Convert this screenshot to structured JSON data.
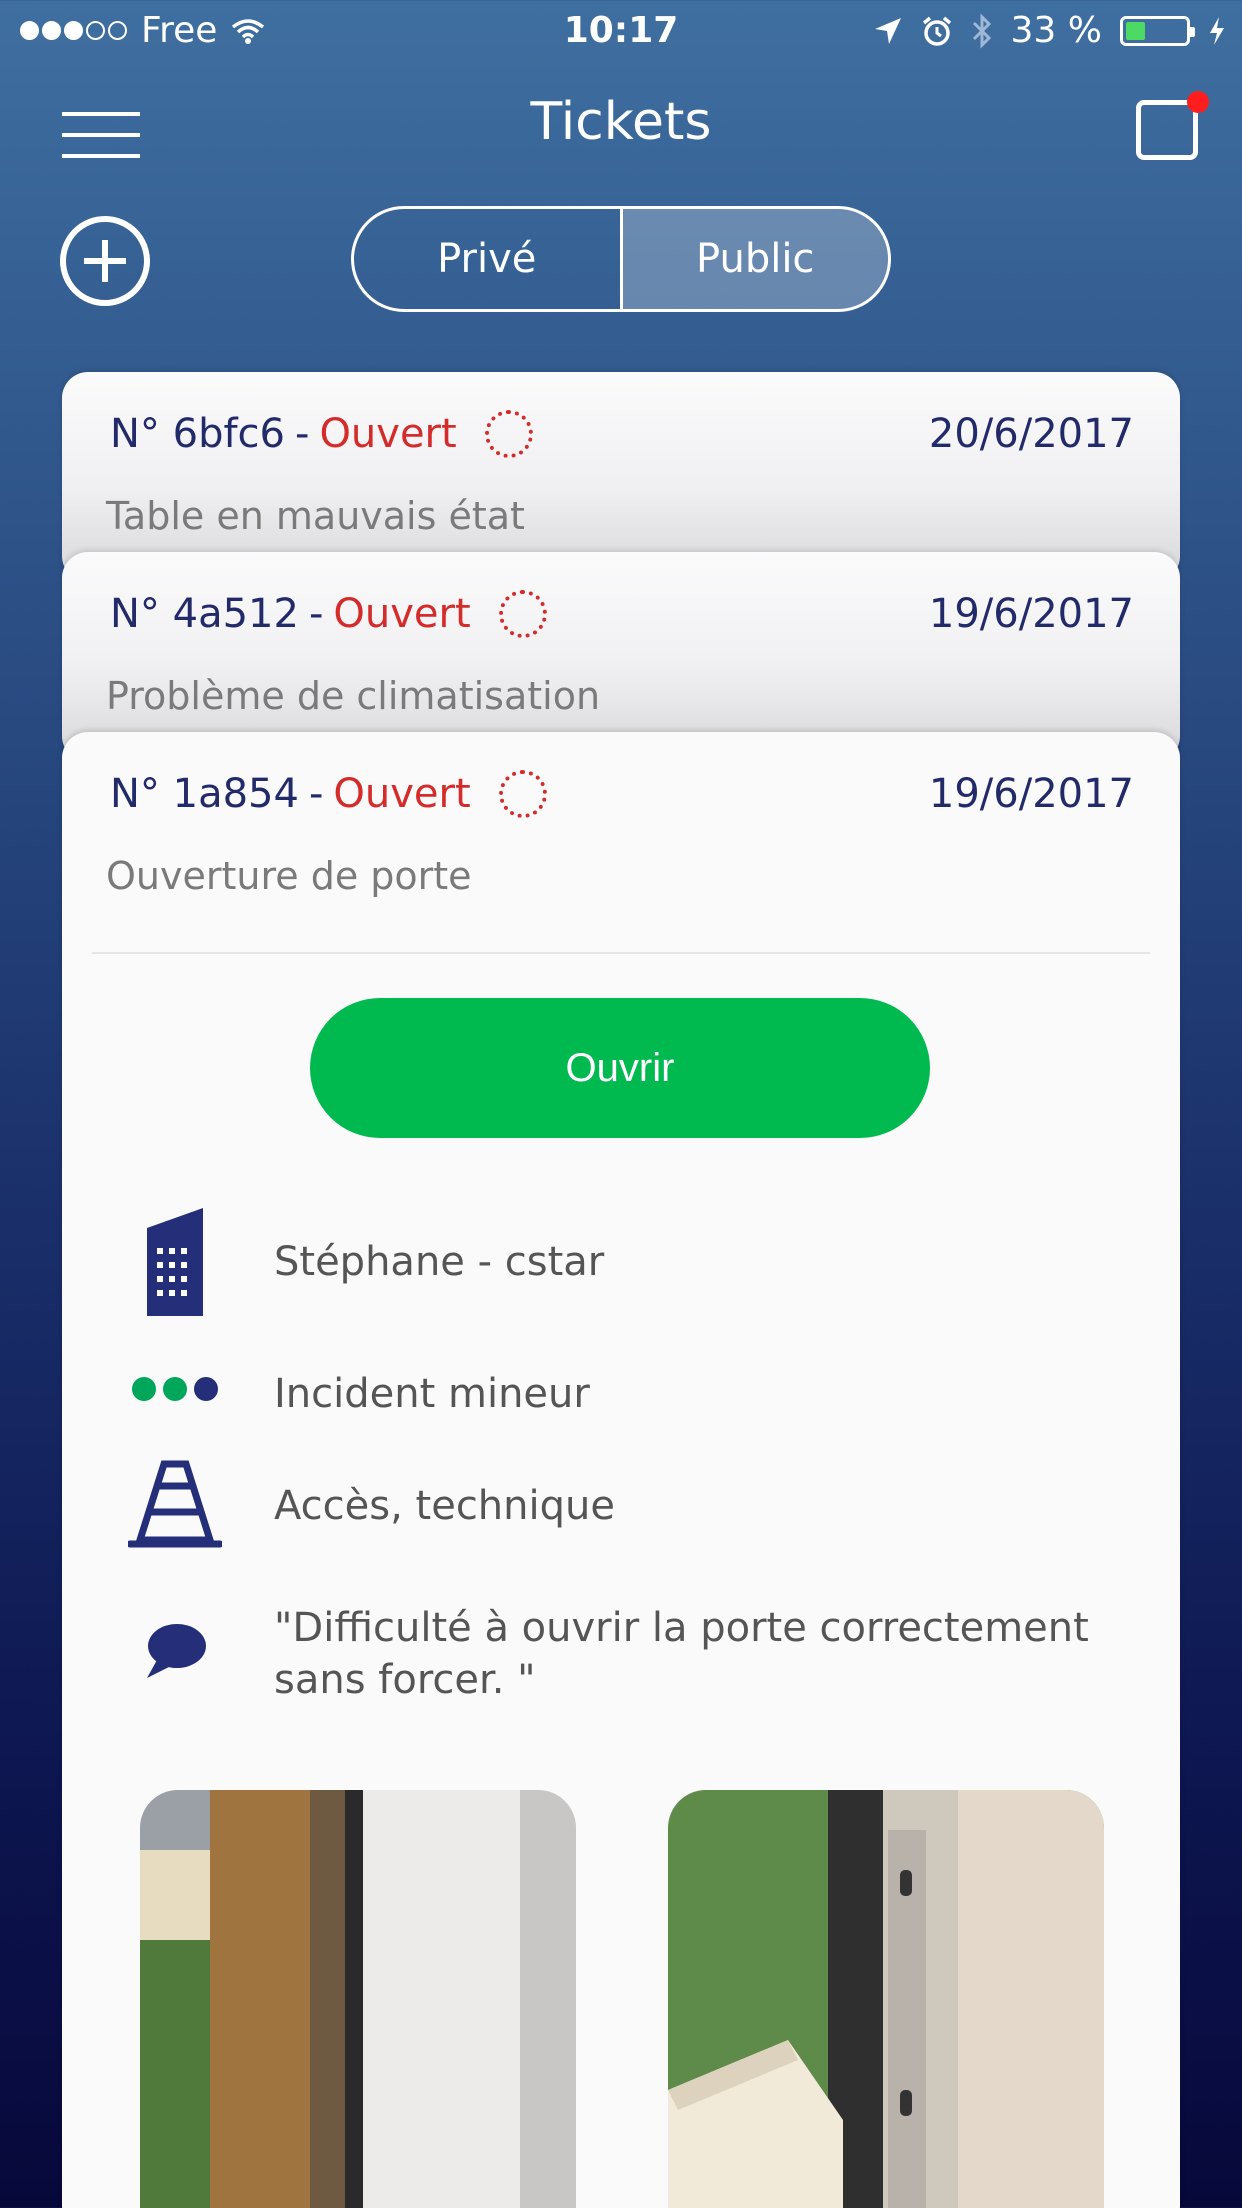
{
  "status_bar": {
    "carrier": "Free",
    "time": "10:17",
    "battery_percent": "33 %",
    "battery_level": 0.33,
    "icons": [
      "wifi-icon",
      "location-arrow-icon",
      "alarm-icon",
      "bluetooth-icon",
      "battery-icon",
      "charging-bolt-icon"
    ]
  },
  "header": {
    "title": "Tickets",
    "menu_icon": "hamburger-menu-icon",
    "notification_icon": "notification-square-icon"
  },
  "segmented": {
    "private_label": "Privé",
    "public_label": "Public",
    "active": "Public"
  },
  "tickets": [
    {
      "number": "N° 6bfc6",
      "separator": "-",
      "status": "Ouvert",
      "date": "20/6/2017",
      "subject": "Table en mauvais état"
    },
    {
      "number": "N° 4a512",
      "separator": "-",
      "status": "Ouvert",
      "date": "19/6/2017",
      "subject": "Problème de climatisation"
    },
    {
      "number": "N° 1a854",
      "separator": "-",
      "status": "Ouvert",
      "date": "19/6/2017",
      "subject": "Ouverture de porte",
      "open_button_label": "Ouvrir",
      "location": "Stéphane - cstar",
      "severity": "Incident mineur",
      "category": "Accès, technique",
      "comment": "\"Difficulté à ouvrir la porte correctement sans forcer. \""
    }
  ],
  "colors": {
    "navy": "#222a6a",
    "status_red": "#d42b2b",
    "button_green": "#00b94f",
    "severity_green": "#00a65a"
  }
}
